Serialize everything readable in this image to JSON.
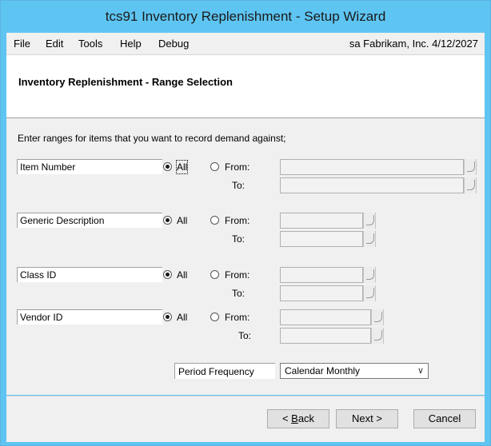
{
  "window": {
    "title": "tcs91 Inventory Replenishment - Setup  Wizard"
  },
  "menu": {
    "items": [
      "File",
      "Edit",
      "Tools",
      "Help",
      "Debug"
    ],
    "status": "sa  Fabrikam, Inc.  4/12/2027"
  },
  "header": {
    "title": "Inventory Replenishment - Range Selection"
  },
  "instruction": "Enter ranges for items that you want to record demand against;",
  "groups": [
    {
      "label": "Item Number",
      "all": "All",
      "from": "From:",
      "to": "To:",
      "selected": "All",
      "from_value": "",
      "to_value": ""
    },
    {
      "label": "Generic Description",
      "all": "All",
      "from": "From:",
      "to": "To:",
      "selected": "All",
      "from_value": "",
      "to_value": ""
    },
    {
      "label": "Class  ID",
      "all": "All",
      "from": "From:",
      "to": "To:",
      "selected": "All",
      "from_value": "",
      "to_value": ""
    },
    {
      "label": "Vendor ID",
      "all": "All",
      "from": "From:",
      "to": "To:",
      "selected": "All",
      "from_value": "",
      "to_value": ""
    }
  ],
  "period_frequency": {
    "label": "Period Frequency",
    "value": "Calendar Monthly"
  },
  "buttons": {
    "back_prefix": "< ",
    "back_key": "B",
    "back_rest": "ack",
    "next": "Next >",
    "cancel": "Cancel"
  },
  "icons": {
    "lookup": "lookup-icon",
    "dropdown": "chevron-down-icon"
  },
  "colors": {
    "titlebar": "#5ec5f2",
    "body": "#f0f0f0",
    "field": "#f2f2f2"
  }
}
